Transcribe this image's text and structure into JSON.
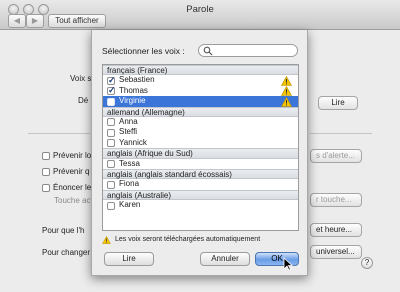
{
  "window": {
    "title": "Parole"
  },
  "toolbar": {
    "show_all": "Tout afficher"
  },
  "background": {
    "voice_label": "Voix s",
    "rate_label": "Dé",
    "read_button": "Lire",
    "check1": "Prévenir lo",
    "check2": "Prévenir q",
    "check3": "Énoncer le",
    "alert_button": "s d'alerte...",
    "touch_label": "Touche act",
    "key_button": "r touche...",
    "time_label": "Pour que l'h",
    "time_button": "et heure...",
    "change_label": "Pour changer",
    "universal_button": "universel..."
  },
  "sheet": {
    "select_label": "Sélectionner les voix :",
    "search": {
      "value": "",
      "placeholder": ""
    },
    "groups": [
      {
        "name": "français (France)",
        "voices": [
          {
            "name": "Sebastien",
            "checked": true,
            "warning": true,
            "selected": false
          },
          {
            "name": "Thomas",
            "checked": true,
            "warning": true,
            "selected": false
          },
          {
            "name": "Virginie",
            "checked": true,
            "warning": true,
            "selected": true
          }
        ]
      },
      {
        "name": "allemand (Allemagne)",
        "voices": [
          {
            "name": "Anna",
            "checked": false,
            "warning": false,
            "selected": false
          },
          {
            "name": "Steffi",
            "checked": false,
            "warning": false,
            "selected": false
          },
          {
            "name": "Yannick",
            "checked": false,
            "warning": false,
            "selected": false
          }
        ]
      },
      {
        "name": "anglais (Afrique du Sud)",
        "voices": [
          {
            "name": "Tessa",
            "checked": false,
            "warning": false,
            "selected": false
          }
        ]
      },
      {
        "name": "anglais (anglais standard écossais)",
        "voices": [
          {
            "name": "Fiona",
            "checked": false,
            "warning": false,
            "selected": false
          }
        ]
      },
      {
        "name": "anglais (Australie)",
        "voices": [
          {
            "name": "Karen",
            "checked": false,
            "warning": false,
            "selected": false
          }
        ]
      }
    ],
    "footnote": "Les voix seront téléchargées automatiquement",
    "buttons": {
      "play": "Lire",
      "cancel": "Annuler",
      "ok": "OK"
    }
  },
  "colors": {
    "selection": "#3b75d8",
    "warning": "#f5c400",
    "default_button": "#6a9de6"
  },
  "icons": {
    "search": "search-icon",
    "warning": "warning-triangle-icon",
    "help": "help-icon",
    "cursor": "pointer-cursor-icon"
  }
}
